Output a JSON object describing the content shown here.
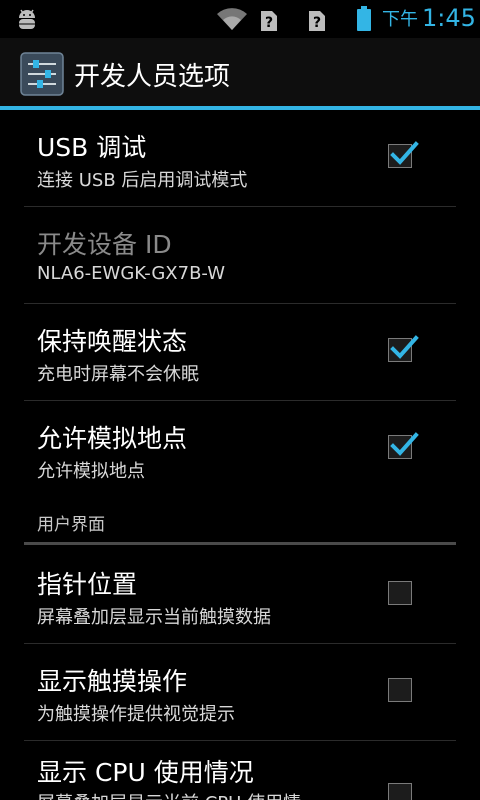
{
  "status_bar": {
    "ampm": "下午",
    "time": "1:45",
    "icons": [
      "android-debug-icon",
      "wifi-icon",
      "no-sim-icon",
      "no-sim-icon",
      "battery-icon"
    ],
    "accent": "#33b5e5"
  },
  "action_bar": {
    "title": "开发人员选项",
    "icon": "settings-sliders-icon"
  },
  "preferences": [
    {
      "title": "USB 调试",
      "summary": "连接 USB 后启用调试模式",
      "checked": true
    },
    {
      "title": "开发设备 ID",
      "summary": "NLA6-EWGK-GX7B-W",
      "disabled": true
    },
    {
      "title": "保持唤醒状态",
      "summary": "充电时屏幕不会休眠",
      "checked": true
    },
    {
      "title": "允许模拟地点",
      "summary": "允许模拟地点",
      "checked": true
    }
  ],
  "category": {
    "label": "用户界面"
  },
  "ui_preferences": [
    {
      "title": "指针位置",
      "summary": "屏幕叠加层显示当前触摸数据",
      "checked": false
    },
    {
      "title": "显示触摸操作",
      "summary": "为触摸操作提供视觉提示",
      "checked": false
    },
    {
      "title": "显示 CPU 使用情况",
      "summary": "屏幕叠加层显示当前 CPU 使用情",
      "checked": false
    }
  ]
}
